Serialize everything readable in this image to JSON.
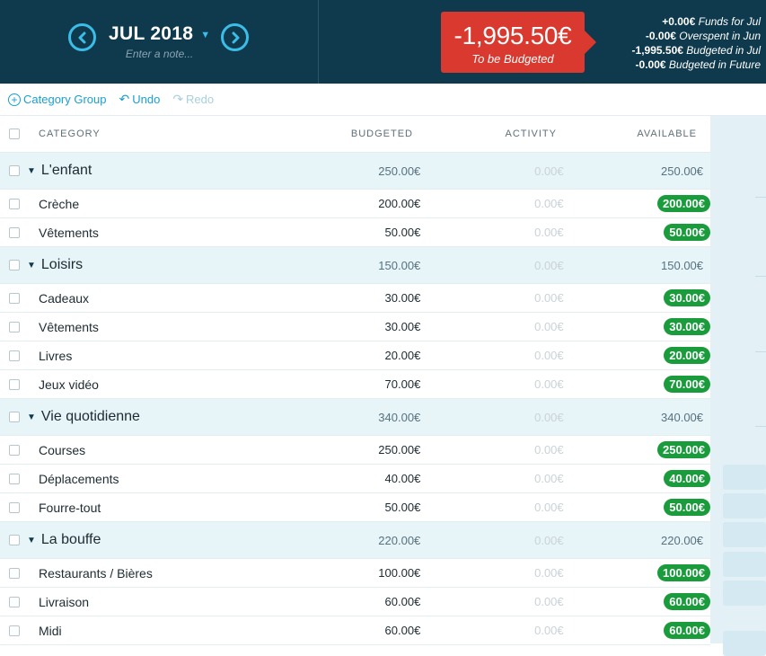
{
  "header": {
    "month": "JUL 2018",
    "note_placeholder": "Enter a note...",
    "to_be_budgeted_amount": "-1,995.50€",
    "to_be_budgeted_label": "To be Budgeted",
    "summary": [
      {
        "value": "+0.00€",
        "label": "Funds for Jul"
      },
      {
        "value": "-0.00€",
        "label": "Overspent in Jun"
      },
      {
        "value": "-1,995.50€",
        "label": "Budgeted in Jul"
      },
      {
        "value": "-0.00€",
        "label": "Budgeted in Future"
      }
    ],
    "colors": {
      "background": "#0f3a4d",
      "accent": "#3bbde8",
      "to_be_budgeted": "#d9392f"
    }
  },
  "toolbar": {
    "category_group": "Category Group",
    "undo": "Undo",
    "redo": "Redo"
  },
  "table": {
    "headers": {
      "category": "CATEGORY",
      "budgeted": "BUDGETED",
      "activity": "ACTIVITY",
      "available": "AVAILABLE"
    },
    "groups": [
      {
        "name": "L'enfant",
        "budgeted": "250.00€",
        "activity": "0.00€",
        "available": "250.00€",
        "items": [
          {
            "name": "Crèche",
            "budgeted": "200.00€",
            "activity": "0.00€",
            "available": "200.00€"
          },
          {
            "name": "Vêtements",
            "budgeted": "50.00€",
            "activity": "0.00€",
            "available": "50.00€"
          }
        ]
      },
      {
        "name": "Loisirs",
        "budgeted": "150.00€",
        "activity": "0.00€",
        "available": "150.00€",
        "items": [
          {
            "name": "Cadeaux",
            "budgeted": "30.00€",
            "activity": "0.00€",
            "available": "30.00€"
          },
          {
            "name": "Vêtements",
            "budgeted": "30.00€",
            "activity": "0.00€",
            "available": "30.00€"
          },
          {
            "name": "Livres",
            "budgeted": "20.00€",
            "activity": "0.00€",
            "available": "20.00€"
          },
          {
            "name": "Jeux vidéo",
            "budgeted": "70.00€",
            "activity": "0.00€",
            "available": "70.00€"
          }
        ]
      },
      {
        "name": "Vie quotidienne",
        "budgeted": "340.00€",
        "activity": "0.00€",
        "available": "340.00€",
        "items": [
          {
            "name": "Courses",
            "budgeted": "250.00€",
            "activity": "0.00€",
            "available": "250.00€"
          },
          {
            "name": "Déplacements",
            "budgeted": "40.00€",
            "activity": "0.00€",
            "available": "40.00€"
          },
          {
            "name": "Fourre-tout",
            "budgeted": "50.00€",
            "activity": "0.00€",
            "available": "50.00€"
          }
        ]
      },
      {
        "name": "La bouffe",
        "budgeted": "220.00€",
        "activity": "0.00€",
        "available": "220.00€",
        "items": [
          {
            "name": "Restaurants / Bières",
            "budgeted": "100.00€",
            "activity": "0.00€",
            "available": "100.00€"
          },
          {
            "name": "Livraison",
            "budgeted": "60.00€",
            "activity": "0.00€",
            "available": "60.00€"
          },
          {
            "name": "Midi",
            "budgeted": "60.00€",
            "activity": "0.00€",
            "available": "60.00€"
          }
        ]
      }
    ],
    "colors": {
      "available_positive": "#1a9c3c",
      "group_row": "#e7f4f8"
    }
  }
}
